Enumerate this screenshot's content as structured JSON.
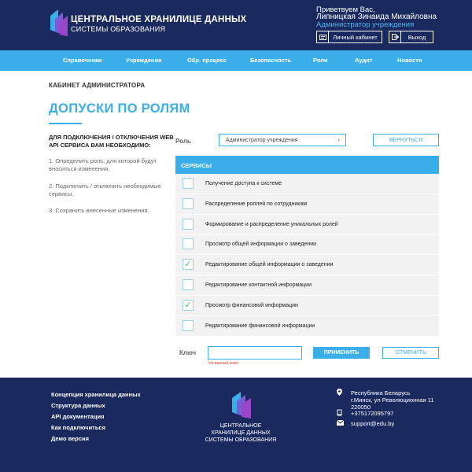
{
  "header": {
    "logo_title": "ЦЕНТРАЛЬНОЕ ХРАНИЛИЦЕ ДАННЫХ",
    "logo_subtitle": "СИСТЕМЫ ОБРАЗОВАНИЯ",
    "greeting": "Приветвуем Вас,",
    "user_name": "Липницкая Зинаида Михайловна",
    "user_role": "Администратор учреждения",
    "cabinet_label": "Личный кабинет",
    "exit_label": "Выход",
    "cabinet_icon": "id-card-icon",
    "exit_icon": "logout-icon"
  },
  "nav": {
    "items": [
      "Справочники",
      "Учреждения",
      "Обр. процесс",
      "Безопасность",
      "Роли",
      "Аудит",
      "Новости"
    ]
  },
  "main": {
    "breadcrumb": "КАБИНЕТ АДМИНИСТРАТОРА",
    "title": "ДОПУСКИ ПО РОЛЯМ",
    "instructions_heading": "ДЛЯ ПОДКЛЮЧЕНИЯ / ОТКЛЮЧЕНИЯ WEB API СЕРВИСА ВАМ НЕОБХОДИМО:",
    "steps": [
      "1. Определить роль, для которой будут вноситься изменения.",
      "2. Подключить / отключить необходимые сервисы.",
      "3. Сохранить внесенные изменения."
    ],
    "role_label": "Роль",
    "role_value": "Администратор учреждения",
    "back_button": "ВЕРНУТЬСЯ",
    "services_header": "СЕРВИСЫ",
    "services": [
      {
        "label": "Получение доступа к системе",
        "checked": false
      },
      {
        "label": "Распределение роллей по сотрудникам",
        "checked": false
      },
      {
        "label": "Формирование и распределение уникальных ролей",
        "checked": false
      },
      {
        "label": "Просмотр общей информации о заведении",
        "checked": false
      },
      {
        "label": "Редактирование общей информации о заведении",
        "checked": true
      },
      {
        "label": "Редактирование контактной информации",
        "checked": false
      },
      {
        "label": "Просмотр финансовой информации",
        "checked": true
      },
      {
        "label": "Редактирование финансовой информации",
        "checked": false
      }
    ],
    "key_label": "Ключ",
    "key_value": "",
    "key_error": "*не верный ключ",
    "apply_button": "ПРИМЕНИТЬ",
    "cancel_button": "ОТМЕНИТЬ"
  },
  "footer": {
    "links": [
      "Концепция хранилица данных",
      "Структура данных",
      "API документация",
      "Как подключиться",
      "Демо версия"
    ],
    "logo_lines": [
      "ЦЕНТРАЛЬНОЕ",
      "ХРАНИЛИЦЕ ДАННЫХ",
      "СИСТЕМЫ ОБРАЗОВАНИЯ"
    ],
    "address_lines": [
      "Республика Беларусь",
      "г.Минск, ул Революционная 11",
      "220050"
    ],
    "phone": "+375172095797",
    "email": "support@edu.by",
    "address_icon": "location-pin-icon",
    "phone_icon": "phone-icon",
    "email_icon": "envelope-icon"
  },
  "colors": {
    "navy": "#1b2a5e",
    "accent_blue": "#3aaee9",
    "check_green": "#5cb85c",
    "error_red": "#e53935"
  }
}
